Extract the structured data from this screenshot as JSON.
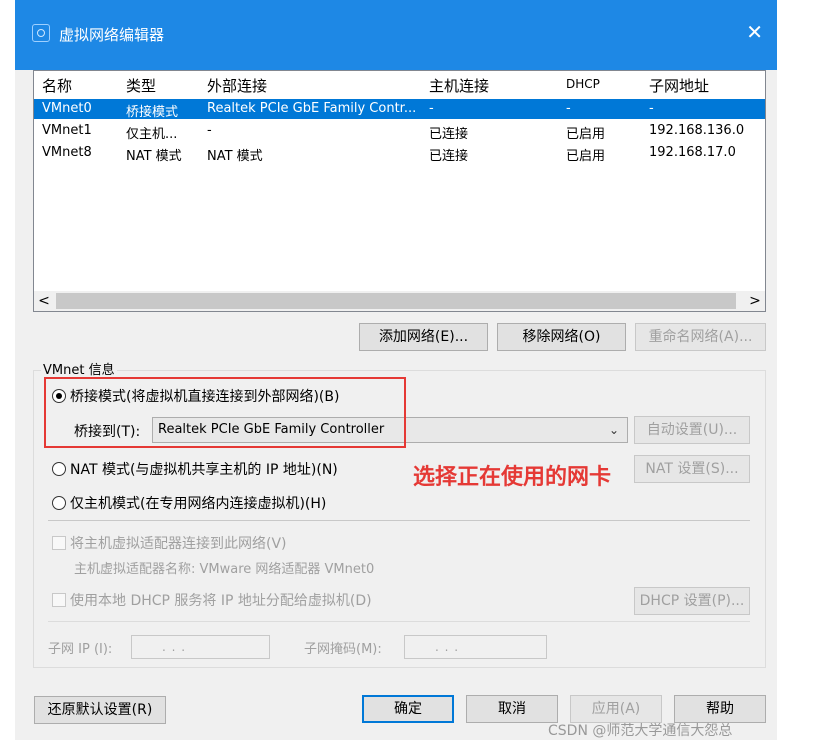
{
  "window": {
    "title": "虚拟网络编辑器",
    "close_glyph": "✕"
  },
  "list": {
    "columns": [
      "名称",
      "类型",
      "外部连接",
      "主机连接",
      "DHCP",
      "子网地址"
    ],
    "rows": [
      {
        "name": "VMnet0",
        "type": "桥接模式",
        "external": "Realtek PCIe GbE Family Contr...",
        "host": "-",
        "dhcp": "-",
        "subnet": "-",
        "selected": true
      },
      {
        "name": "VMnet1",
        "type": "仅主机...",
        "external": "-",
        "host": "已连接",
        "dhcp": "已启用",
        "subnet": "192.168.136.0"
      },
      {
        "name": "VMnet8",
        "type": "NAT 模式",
        "external": "NAT 模式",
        "host": "已连接",
        "dhcp": "已启用",
        "subnet": "192.168.17.0"
      }
    ],
    "scroll_left": "<",
    "scroll_right": ">"
  },
  "list_buttons": {
    "add": "添加网络(E)...",
    "remove": "移除网络(O)",
    "rename": "重命名网络(A)..."
  },
  "vmnet_info": {
    "label": "VMnet 信息",
    "bridge_radio": "桥接模式(将虚拟机直接连接到外部网络)(B)",
    "bridge_to_label": "桥接到(T):",
    "bridge_to_value": "Realtek PCIe GbE Family Controller",
    "auto_button": "自动设置(U)...",
    "nat_radio": "NAT 模式(与虚拟机共享主机的 IP 地址)(N)",
    "nat_button": "NAT 设置(S)...",
    "host_only_radio": "仅主机模式(在专用网络内连接虚拟机)(H)",
    "connect_adapter": "将主机虚拟适配器连接到此网络(V)",
    "adapter_name": "主机虚拟适配器名称: VMware 网络适配器 VMnet0",
    "use_dhcp": "使用本地 DHCP 服务将 IP 地址分配给虚拟机(D)",
    "dhcp_button": "DHCP 设置(P)...",
    "subnet_ip_label": "子网 IP (I):",
    "subnet_mask_label": "子网掩码(M):",
    "ip_placeholder": ".     .     .",
    "selected_mode": "bridge"
  },
  "annotation": "选择正在使用的网卡",
  "bottom_buttons": {
    "restore": "还原默认设置(R)",
    "ok": "确定",
    "cancel": "取消",
    "apply": "应用(A)",
    "help": "帮助"
  },
  "watermark": "CSDN @师范大学通信大怨总",
  "colors": {
    "title_bar": "#1e88e5",
    "selection": "#0078d7",
    "annotation": "#e53935"
  }
}
